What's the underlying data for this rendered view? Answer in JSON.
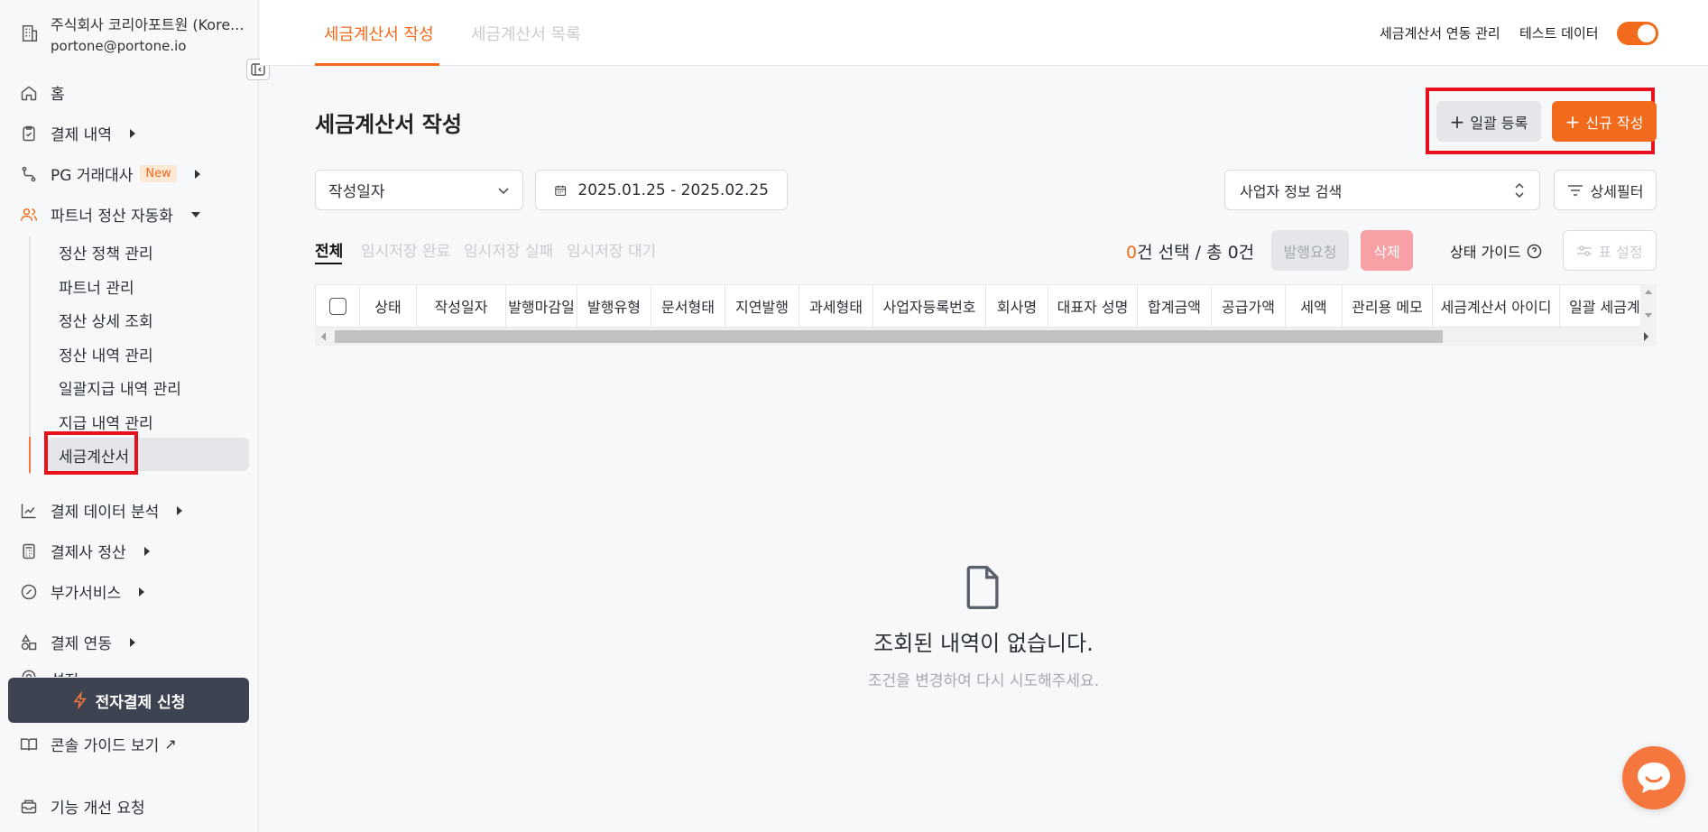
{
  "org": {
    "name": "주식회사 코리아포트원 (Kore...",
    "email": "portone@portone.io"
  },
  "sidebar": {
    "items": [
      {
        "label": "홈",
        "icon": "home-icon"
      },
      {
        "label": "결제 내역",
        "icon": "clipboard-check-icon"
      },
      {
        "label": "PG 거래대사",
        "icon": "route-icon",
        "badge": "New"
      },
      {
        "label": "파트너 정산 자동화",
        "icon": "users-icon"
      },
      {
        "label": "결제 데이터 분석",
        "icon": "chart-line-icon"
      },
      {
        "label": "결제사 정산",
        "icon": "calculator-icon"
      },
      {
        "label": "부가서비스",
        "icon": "badge-percent-icon"
      },
      {
        "label": "결제 연동",
        "icon": "shapes-icon"
      },
      {
        "label": "설정",
        "icon": "settings-icon"
      }
    ],
    "sub_items": [
      "정산 정책 관리",
      "파트너 관리",
      "정산 상세 조회",
      "정산 내역 관리",
      "일괄지급 내역 관리",
      "지급 내역 관리",
      "세금계산서"
    ],
    "apply_button": "전자결제 신청",
    "console_guide": "콘솔 가이드 보기",
    "feature_request": "기능 개선 요청"
  },
  "topbar": {
    "tabs": [
      "세금계산서 작성",
      "세금계산서 목록"
    ],
    "integration_link": "세금계산서 연동 관리",
    "test_data_label": "테스트 데이터",
    "test_data_on": true
  },
  "main": {
    "title": "세금계산서 작성",
    "bulk_register": "일괄 등록",
    "new_create": "신규 작성",
    "date_type": "작성일자",
    "date_range": "2025.01.25 - 2025.02.25",
    "business_search": "사업자 정보 검색",
    "detail_filter": "상세필터",
    "status_tabs": [
      "전체",
      "임시저장 완료",
      "임시저장 실패",
      "임시저장 대기"
    ],
    "selected_count": "0",
    "count_text": "건 선택 / 총 0건",
    "issue_request": "발행요청",
    "delete": "삭제",
    "status_guide": "상태 가이드",
    "table_setting": "표 설정",
    "columns": [
      "상태",
      "작성일자",
      "발행마감일",
      "발행유형",
      "문서형태",
      "지연발행",
      "과세형태",
      "사업자등록번호",
      "회사명",
      "대표자 성명",
      "합계금액",
      "공급가액",
      "세액",
      "관리용 메모",
      "세금계산서 아이디",
      "일괄 세금계"
    ],
    "empty_title": "조회된 내역이 없습니다.",
    "empty_sub": "조건을 변경하여 다시 시도해주세요."
  },
  "colors": {
    "accent": "#f26a1b",
    "highlight": "#e8111b",
    "dark_button": "#3d4350"
  }
}
